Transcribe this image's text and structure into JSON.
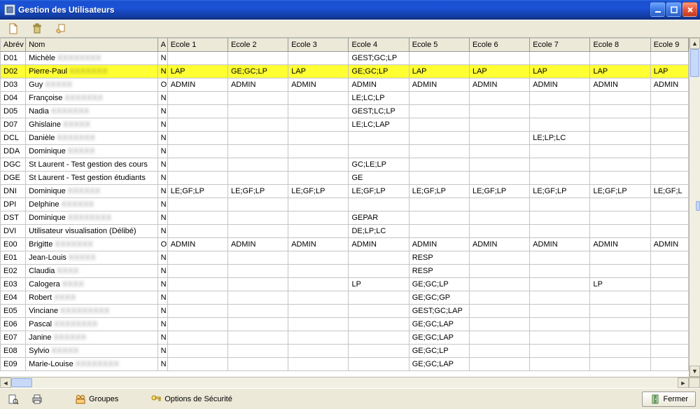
{
  "window": {
    "title": "Gestion des Utilisateurs"
  },
  "columns": {
    "abrev": "Abrév",
    "nom": "Nom",
    "a": "A",
    "e1": "Ecole 1",
    "e2": "Ecole 2",
    "e3": "Ecole 3",
    "e4": "Ecole 4",
    "e5": "Ecole 5",
    "e6": "Ecole 6",
    "e7": "Ecole 7",
    "e8": "Ecole 8",
    "e9": "Ecole 9"
  },
  "toolbar_bottom": {
    "groupes": "Groupes",
    "options": "Options de Sécurité",
    "fermer": "Fermer"
  },
  "rows": [
    {
      "abrev": "D01",
      "prenom": "Michèle",
      "nom": "XXXXXXXX",
      "a": "N",
      "e": [
        "",
        "",
        "",
        "GEST;GC;LP",
        "",
        "",
        "",
        "",
        ""
      ],
      "sel": false
    },
    {
      "abrev": "D02",
      "prenom": "Pierre-Paul",
      "nom": "XXXXXXX",
      "a": "N",
      "e": [
        "LAP",
        "GE;GC;LP",
        "LAP",
        "GE;GC;LP",
        "LAP",
        "LAP",
        "LAP",
        "LAP",
        "LAP"
      ],
      "sel": true
    },
    {
      "abrev": "D03",
      "prenom": "Guy",
      "nom": "XXXXX",
      "a": "O",
      "e": [
        "ADMIN",
        "ADMIN",
        "ADMIN",
        "ADMIN",
        "ADMIN",
        "ADMIN",
        "ADMIN",
        "ADMIN",
        "ADMIN"
      ],
      "sel": false
    },
    {
      "abrev": "D04",
      "prenom": "Françoise",
      "nom": "XXXXXXX",
      "a": "N",
      "e": [
        "",
        "",
        "",
        "LE;LC;LP",
        "",
        "",
        "",
        "",
        ""
      ],
      "sel": false
    },
    {
      "abrev": "D05",
      "prenom": "Nadia",
      "nom": "XXXXXXX",
      "a": "N",
      "e": [
        "",
        "",
        "",
        "GEST;LC;LP",
        "",
        "",
        "",
        "",
        ""
      ],
      "sel": false
    },
    {
      "abrev": "D07",
      "prenom": "Ghislaine",
      "nom": "XXXXX",
      "a": "N",
      "e": [
        "",
        "",
        "",
        "LE;LC;LAP",
        "",
        "",
        "",
        "",
        ""
      ],
      "sel": false
    },
    {
      "abrev": "DCL",
      "prenom": "Danièle",
      "nom": "XXXXXXX",
      "a": "N",
      "e": [
        "",
        "",
        "",
        "",
        "",
        "",
        "LE;LP;LC",
        "",
        ""
      ],
      "sel": false
    },
    {
      "abrev": "DDA",
      "prenom": "Dominique",
      "nom": "XXXXX",
      "a": "N",
      "e": [
        "",
        "",
        "",
        "",
        "",
        "",
        "",
        "",
        ""
      ],
      "sel": false
    },
    {
      "abrev": "DGC",
      "prenom": "St Laurent - Test gestion des cours",
      "nom": "",
      "a": "N",
      "e": [
        "",
        "",
        "",
        "GC;LE;LP",
        "",
        "",
        "",
        "",
        ""
      ],
      "sel": false
    },
    {
      "abrev": "DGE",
      "prenom": "St Laurent - Test gestion étudiants",
      "nom": "",
      "a": "N",
      "e": [
        "",
        "",
        "",
        "GE",
        "",
        "",
        "",
        "",
        ""
      ],
      "sel": false
    },
    {
      "abrev": "DNI",
      "prenom": "Dominique",
      "nom": "XXXXXX",
      "a": "N",
      "e": [
        "LE;GF;LP",
        "LE;GF;LP",
        "LE;GF;LP",
        "LE;GF;LP",
        "LE;GF;LP",
        "LE;GF;LP",
        "LE;GF;LP",
        "LE;GF;LP",
        "LE;GF;L"
      ],
      "sel": false
    },
    {
      "abrev": "DPI",
      "prenom": "Delphine",
      "nom": "XXXXXX",
      "a": "N",
      "e": [
        "",
        "",
        "",
        "",
        "",
        "",
        "",
        "",
        ""
      ],
      "sel": false
    },
    {
      "abrev": "DST",
      "prenom": "Dominique",
      "nom": "XXXXXXXX",
      "a": "N",
      "e": [
        "",
        "",
        "",
        "GEPAR",
        "",
        "",
        "",
        "",
        ""
      ],
      "sel": false
    },
    {
      "abrev": "DVI",
      "prenom": "Utilisateur visualisation (Délibé)",
      "nom": "",
      "a": "N",
      "e": [
        "",
        "",
        "",
        "DE;LP;LC",
        "",
        "",
        "",
        "",
        ""
      ],
      "sel": false
    },
    {
      "abrev": "E00",
      "prenom": "Brigitte",
      "nom": "XXXXXXX",
      "a": "O",
      "e": [
        "ADMIN",
        "ADMIN",
        "ADMIN",
        "ADMIN",
        "ADMIN",
        "ADMIN",
        "ADMIN",
        "ADMIN",
        "ADMIN"
      ],
      "sel": false
    },
    {
      "abrev": "E01",
      "prenom": "Jean-Louis",
      "nom": "XXXXX",
      "a": "N",
      "e": [
        "",
        "",
        "",
        "",
        "RESP",
        "",
        "",
        "",
        ""
      ],
      "sel": false
    },
    {
      "abrev": "E02",
      "prenom": "Claudia",
      "nom": "XXXX",
      "a": "N",
      "e": [
        "",
        "",
        "",
        "",
        "RESP",
        "",
        "",
        "",
        ""
      ],
      "sel": false
    },
    {
      "abrev": "E03",
      "prenom": "Calogera",
      "nom": "XXXX",
      "a": "N",
      "e": [
        "",
        "",
        "",
        "LP",
        "GE;GC;LP",
        "",
        "",
        "LP",
        ""
      ],
      "sel": false
    },
    {
      "abrev": "E04",
      "prenom": "Robert",
      "nom": "XXXX",
      "a": "N",
      "e": [
        "",
        "",
        "",
        "",
        "GE;GC;GP",
        "",
        "",
        "",
        ""
      ],
      "sel": false
    },
    {
      "abrev": "E05",
      "prenom": "Vinciane",
      "nom": "XXXXXXXXX",
      "a": "N",
      "e": [
        "",
        "",
        "",
        "",
        "GEST;GC;LAP",
        "",
        "",
        "",
        ""
      ],
      "sel": false
    },
    {
      "abrev": "E06",
      "prenom": "Pascal",
      "nom": "XXXXXXXX",
      "a": "N",
      "e": [
        "",
        "",
        "",
        "",
        "GE;GC;LAP",
        "",
        "",
        "",
        ""
      ],
      "sel": false
    },
    {
      "abrev": "E07",
      "prenom": "Janine",
      "nom": "XXXXXX",
      "a": "N",
      "e": [
        "",
        "",
        "",
        "",
        "GE;GC;LAP",
        "",
        "",
        "",
        ""
      ],
      "sel": false
    },
    {
      "abrev": "E08",
      "prenom": "Sylvio",
      "nom": "XXXXX",
      "a": "N",
      "e": [
        "",
        "",
        "",
        "",
        "GE;GC;LP",
        "",
        "",
        "",
        ""
      ],
      "sel": false
    },
    {
      "abrev": "E09",
      "prenom": "Marie-Louise",
      "nom": "XXXXXXXX",
      "a": "N",
      "e": [
        "",
        "",
        "",
        "",
        "GE;GC;LAP",
        "",
        "",
        "",
        ""
      ],
      "sel": false
    }
  ]
}
